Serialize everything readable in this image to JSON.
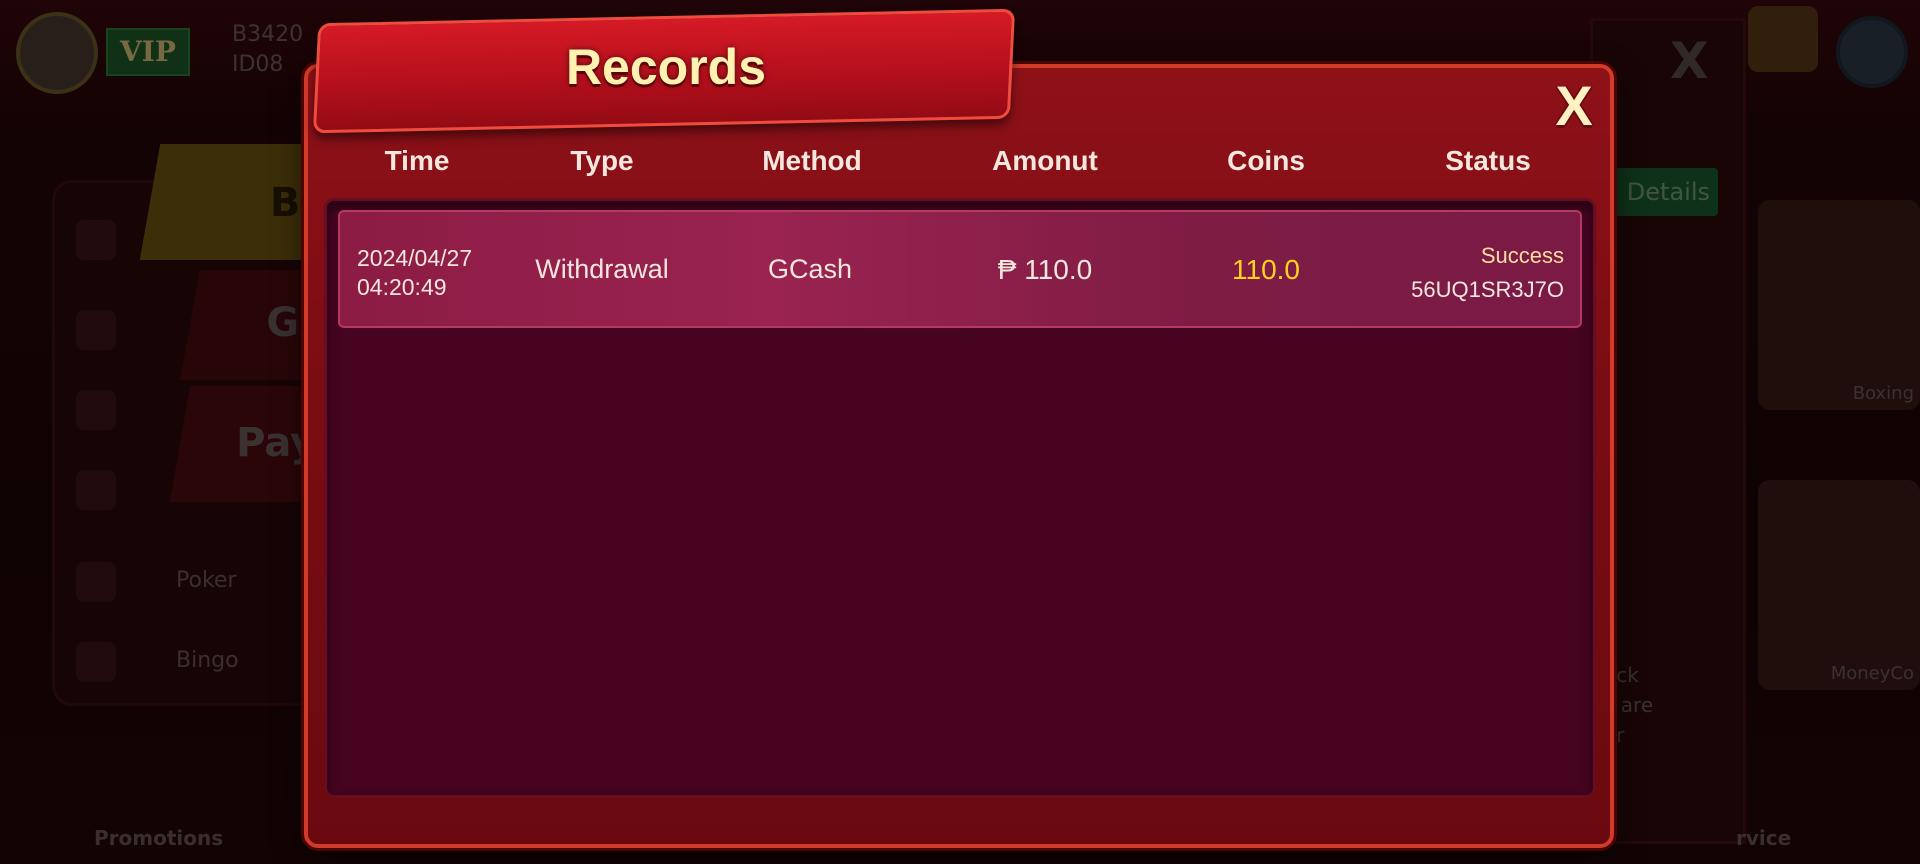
{
  "background": {
    "user_name": "B3420",
    "user_id": "ID08",
    "vip_label": "VIP",
    "details_button": "Details",
    "tabs": [
      "B",
      "G",
      "Pay"
    ],
    "sidebar": [
      "Poker",
      "Bingo"
    ],
    "games": [
      "Boxing",
      "MoneyCo"
    ],
    "bottom_nav": [
      "Promotions",
      "rvice"
    ],
    "hint_text": [
      "eck",
      "s are",
      "er"
    ]
  },
  "modal": {
    "title": "Records",
    "close_label": "X",
    "columns": [
      "Time",
      "Type",
      "Method",
      "Amonut",
      "Coins",
      "Status"
    ],
    "records": [
      {
        "date": "2024/04/27",
        "time": "04:20:49",
        "type": "Withdrawal",
        "method": "GCash",
        "amount": "₱ 110.0",
        "coins": "110.0",
        "status": "Success",
        "order_id": "56UQ1SR3J7O"
      }
    ]
  },
  "colors": {
    "modal_red": "#8f1118",
    "title_text": "#fff2b0",
    "coins_yellow": "#ffd21e",
    "row_pink": "#9a2350",
    "list_bg": "#460421"
  }
}
